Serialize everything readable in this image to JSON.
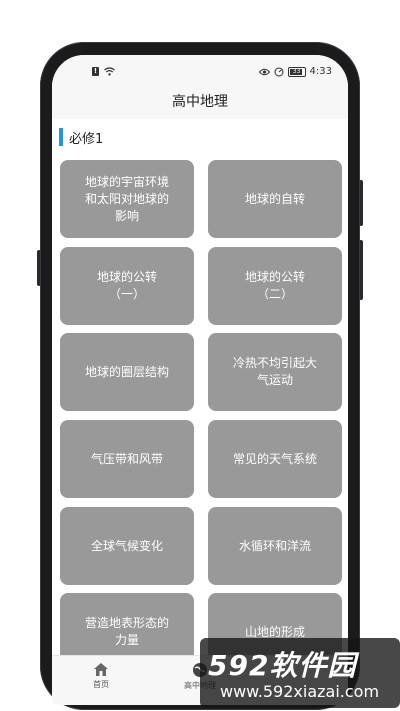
{
  "status_bar": {
    "time": "4:33",
    "battery": "33"
  },
  "header": {
    "title": "高中地理"
  },
  "section": {
    "title": "必修1"
  },
  "cards": [
    {
      "label": "地球的宇宙环境\n和太阳对地球的\n影响"
    },
    {
      "label": "地球的自转"
    },
    {
      "label": "地球的公转\n（一）"
    },
    {
      "label": "地球的公转\n（二）"
    },
    {
      "label": "地球的圈层结构"
    },
    {
      "label": "冷热不均引起大\n气运动"
    },
    {
      "label": "气压带和风带"
    },
    {
      "label": "常见的天气系统"
    },
    {
      "label": "全球气候变化"
    },
    {
      "label": "水循环和洋流"
    },
    {
      "label": "营造地表形态的\n力量"
    },
    {
      "label": "山地的形成"
    }
  ],
  "bottom_nav": {
    "items": [
      {
        "label": "首页",
        "icon": "home-icon"
      },
      {
        "label": "高中地理",
        "icon": "globe-icon"
      }
    ]
  },
  "watermark": {
    "brand": "592软件园",
    "url": "www.592xiazai.com"
  },
  "colors": {
    "card_bg": "#999999",
    "accent": "#2a93d5",
    "bar_bg": "#f7f7f7"
  }
}
